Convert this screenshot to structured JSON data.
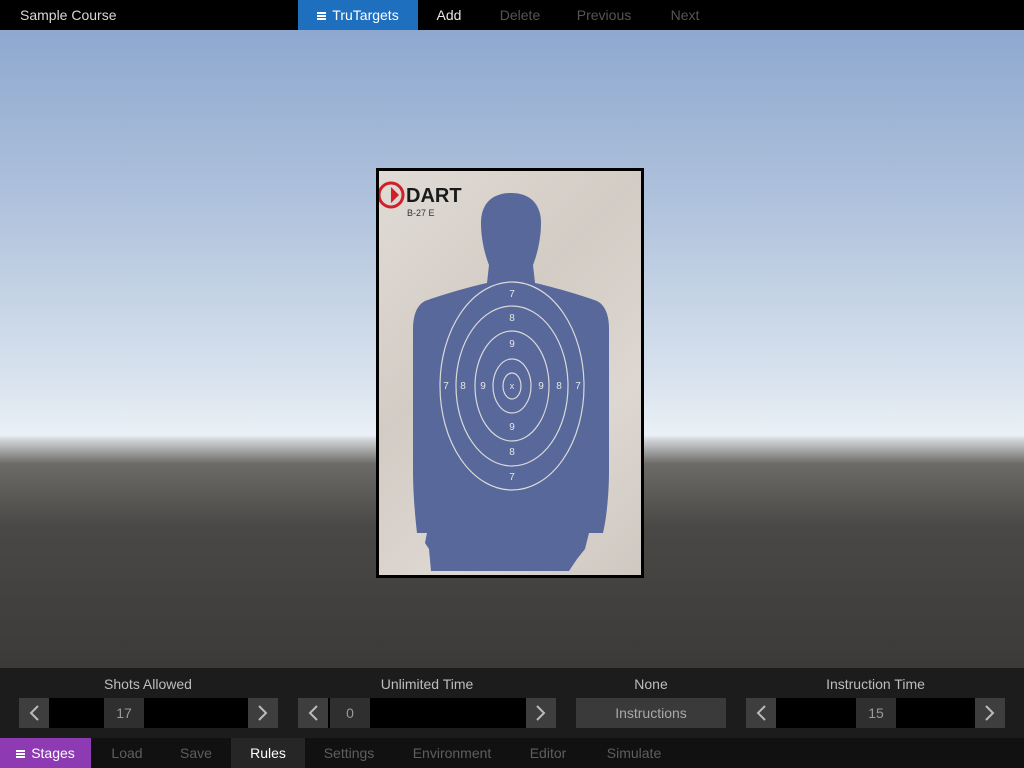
{
  "topbar": {
    "course_title": "Sample Course",
    "trutargets_label": "TruTargets",
    "add_label": "Add",
    "delete_label": "Delete",
    "previous_label": "Previous",
    "next_label": "Next"
  },
  "target": {
    "brand": "DART",
    "model": "B-27 E",
    "ring_labels": {
      "ring7": "7",
      "ring8": "8",
      "ring9": "9",
      "center": "x"
    }
  },
  "controls": {
    "shots_allowed": {
      "label": "Shots Allowed",
      "value": "17"
    },
    "time": {
      "label": "Unlimited Time",
      "value": "0"
    },
    "instructions": {
      "label": "None",
      "button_label": "Instructions"
    },
    "instruction_time": {
      "label": "Instruction Time",
      "value": "15"
    }
  },
  "bottomnav": {
    "stages_label": "Stages",
    "load_label": "Load",
    "save_label": "Save",
    "rules_label": "Rules",
    "settings_label": "Settings",
    "environment_label": "Environment",
    "editor_label": "Editor",
    "simulate_label": "Simulate",
    "active_tab": "Rules"
  },
  "colors": {
    "primary_blue": "#1f6fbf",
    "stages_purple": "#8e3ab3",
    "silhouette": "#58689a",
    "logo_red": "#d0202a"
  },
  "icons": [
    "menu-icon",
    "chevron-left-icon",
    "chevron-right-icon"
  ]
}
